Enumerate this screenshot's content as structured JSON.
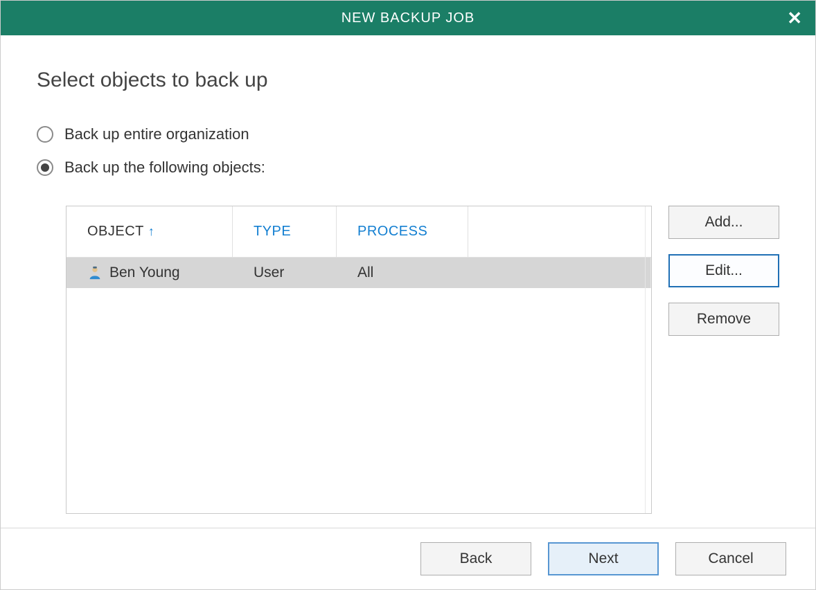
{
  "title": "NEW BACKUP JOB",
  "heading": "Select objects to back up",
  "radios": {
    "entire": "Back up entire organization",
    "following": "Back up the following objects:"
  },
  "selected_radio": "following",
  "table": {
    "headers": {
      "object": "OBJECT",
      "type": "TYPE",
      "process": "PROCESS"
    },
    "sort_indicator": "↑",
    "rows": [
      {
        "object": "Ben Young",
        "type": "User",
        "process": "All"
      }
    ]
  },
  "side_buttons": {
    "add": "Add...",
    "edit": "Edit...",
    "remove": "Remove"
  },
  "footer": {
    "back": "Back",
    "next": "Next",
    "cancel": "Cancel"
  }
}
